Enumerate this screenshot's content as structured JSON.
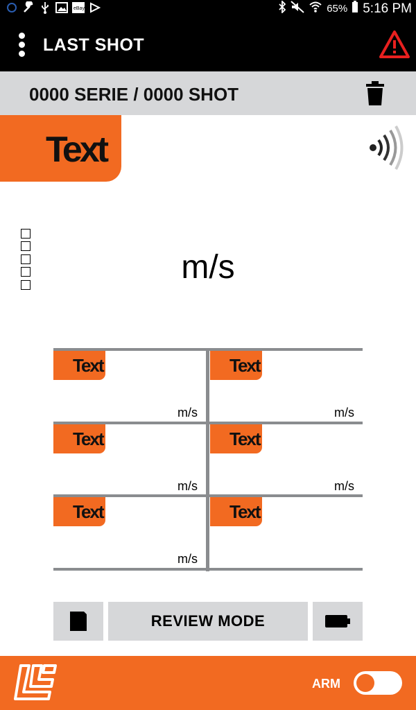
{
  "status_bar": {
    "battery": "65%",
    "time": "5:16 PM",
    "left_icons": [
      "notification-icon",
      "wrench-icon",
      "usb-icon",
      "image-icon",
      "ebay-icon",
      "play-icon"
    ],
    "right_icons": [
      "bluetooth-icon",
      "mute-icon",
      "wifi-icon",
      "battery-icon"
    ]
  },
  "app_bar": {
    "title": "LAST SHOT",
    "warning_color": "#e8201f"
  },
  "serie_bar": {
    "label": "0000 SERIE / 0000 SHOT"
  },
  "main": {
    "tab_label": "Text",
    "unit": "m/s",
    "checkbox_count": 5
  },
  "grid": {
    "cells": [
      {
        "label": "Text",
        "unit": "m/s"
      },
      {
        "label": "Text",
        "unit": "m/s"
      },
      {
        "label": "Text",
        "unit": "m/s"
      },
      {
        "label": "Text",
        "unit": "m/s"
      },
      {
        "label": "Text",
        "unit": "m/s"
      },
      {
        "label": "Text",
        "unit": ""
      }
    ]
  },
  "buttons": {
    "review_mode": "REVIEW MODE"
  },
  "footer": {
    "arm_label": "ARM",
    "arm_on": false
  },
  "colors": {
    "accent": "#f26a21",
    "bar_gray": "#d6d7d9",
    "grid_line": "#8a8c8f"
  }
}
